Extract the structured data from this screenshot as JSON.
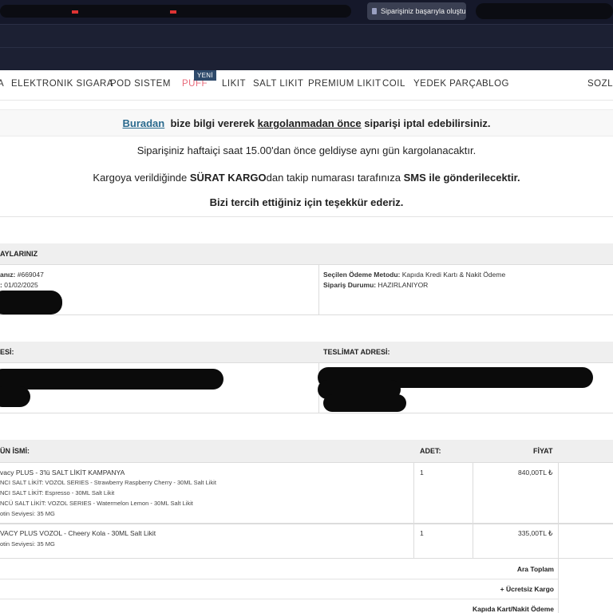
{
  "browser": {
    "notification": "Siparişiniz başarıyla oluştu"
  },
  "nav": {
    "items": [
      "ELEKTRONIK SIGARA",
      "POD SISTEM",
      "PUFF",
      "LIKIT",
      "SALT LIKIT",
      "PREMIUM LIKIT",
      "COIL",
      "YEDEK PARÇA",
      "BLOG",
      "SOZLE"
    ],
    "badge": "YENİ"
  },
  "notice": {
    "link": "Buradan",
    "line1_part1": "bize bilgi vererek",
    "line1_underlined": "kargolanmadan önce",
    "line1_part2": "siparişi iptal edebilirsiniz.",
    "line2": "Siparişiniz haftaiçi saat 15.00'dan önce geldiyse aynı gün kargolanacaktır.",
    "line3_part1": "Kargoya verildiğinde",
    "line3_bold1": "SÜRAT KARGO",
    "line3_part2": "dan takip numarası tarafınıza",
    "line3_bold2": "SMS ile gönderilecektir.",
    "line4": "Bizi tercih ettiğiniz için teşekkür ederiz."
  },
  "order": {
    "heading": "AYLARINIZ",
    "number_label": "anız:",
    "number": "#669047",
    "date_label": ":",
    "date": "01/02/2025",
    "payment_label": "Seçilen Ödeme Metodu:",
    "payment": "Kapıda Kredi Kartı & Nakit Ödeme",
    "status_label": "Sipariş Durumu:",
    "status": "HAZIRLANIYOR"
  },
  "address": {
    "billing_heading": "ESİ:",
    "shipping_heading": "TESLİMAT ADRESİ:"
  },
  "products": {
    "headers": {
      "name": "ÜN İSMİ:",
      "qty": "ADET:",
      "price": "FİYAT"
    },
    "rows": [
      {
        "name": "vacy PLUS - 3'lü SALT LİKİT KAMPANYA",
        "details": [
          "NCI SALT LİKİT: VOZOL SERIES - Strawberry Raspberry Cherry - 30ML Salt Likit",
          "NCI SALT LİKİT: Espresso - 30ML Salt Likit",
          "NCÜ SALT LİKİT: VOZOL SERIES - Watermelon Lemon - 30ML Salt Likit",
          "otin Seviyesi: 35 MG"
        ],
        "qty": "1",
        "price": "840,00TL ₺"
      },
      {
        "name": "VACY PLUS VOZOL - Cheery Kola - 30ML Salt Likit",
        "details": [
          "otin Seviyesi: 35 MG"
        ],
        "qty": "1",
        "price": "335,00TL ₺"
      }
    ]
  },
  "totals": {
    "subtotal_label": "Ara Toplam",
    "shipping_label": "+ Ücretsiz Kargo",
    "payment_label": "Kapıda Kart/Nakit Ödeme"
  }
}
